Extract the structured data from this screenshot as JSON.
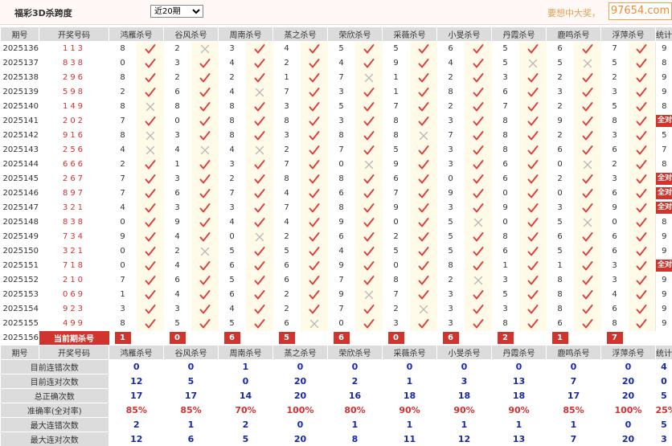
{
  "header": {
    "title": "福彩3D杀跨度",
    "select_value": "近20期",
    "promo": "要想中大奖，",
    "watermark": "97654.com"
  },
  "columns": {
    "period": "期号",
    "draw": "开奖号码",
    "total": "统计",
    "experts": [
      "鸿雁杀号",
      "谷风杀号",
      "周南杀号",
      "蒸之杀号",
      "荣欣杀号",
      "采薇杀号",
      "小旻杀号",
      "丹霞杀号",
      "鹿鸣杀号",
      "浮萍杀号"
    ]
  },
  "rows": [
    {
      "period": "2025136",
      "draw": "113",
      "n": [
        8,
        2,
        3,
        4,
        5,
        5,
        6,
        5,
        6,
        7
      ],
      "m": [
        1,
        0,
        1,
        1,
        1,
        1,
        1,
        1,
        1,
        1
      ],
      "total": "9"
    },
    {
      "period": "2025137",
      "draw": "838",
      "n": [
        0,
        3,
        4,
        2,
        4,
        9,
        4,
        5,
        5,
        5
      ],
      "m": [
        1,
        1,
        1,
        1,
        1,
        1,
        1,
        0,
        0,
        1
      ],
      "total": "8"
    },
    {
      "period": "2025138",
      "draw": "296",
      "n": [
        8,
        2,
        2,
        1,
        7,
        1,
        2,
        3,
        2,
        2
      ],
      "m": [
        1,
        1,
        1,
        1,
        0,
        1,
        1,
        1,
        1,
        1
      ],
      "total": "9"
    },
    {
      "period": "2025139",
      "draw": "598",
      "n": [
        2,
        6,
        4,
        7,
        3,
        1,
        8,
        6,
        3,
        3
      ],
      "m": [
        1,
        1,
        0,
        1,
        1,
        1,
        1,
        1,
        1,
        1
      ],
      "total": "9"
    },
    {
      "period": "2025140",
      "draw": "149",
      "n": [
        8,
        8,
        8,
        3,
        5,
        7,
        2,
        7,
        2,
        5
      ],
      "m": [
        0,
        1,
        1,
        1,
        1,
        1,
        1,
        1,
        1,
        1
      ],
      "total": "8"
    },
    {
      "period": "2025141",
      "draw": "202",
      "n": [
        7,
        0,
        8,
        8,
        3,
        8,
        3,
        8,
        9,
        8
      ],
      "m": [
        1,
        1,
        1,
        1,
        1,
        1,
        1,
        1,
        1,
        1
      ],
      "total": "全对"
    },
    {
      "period": "2025142",
      "draw": "916",
      "n": [
        8,
        3,
        8,
        3,
        8,
        8,
        7,
        8,
        2,
        3
      ],
      "m": [
        0,
        1,
        1,
        1,
        1,
        0,
        1,
        1,
        1,
        1
      ],
      "total": "5"
    },
    {
      "period": "2025143",
      "draw": "256",
      "n": [
        4,
        4,
        4,
        2,
        7,
        5,
        3,
        8,
        6,
        6
      ],
      "m": [
        0,
        0,
        0,
        1,
        1,
        1,
        1,
        1,
        1,
        1
      ],
      "total": "7"
    },
    {
      "period": "2025144",
      "draw": "666",
      "n": [
        2,
        1,
        3,
        7,
        0,
        9,
        3,
        6,
        0,
        2
      ],
      "m": [
        1,
        1,
        1,
        1,
        0,
        1,
        1,
        1,
        0,
        1
      ],
      "total": "8"
    },
    {
      "period": "2025145",
      "draw": "267",
      "n": [
        7,
        3,
        2,
        8,
        8,
        6,
        0,
        6,
        2,
        3
      ],
      "m": [
        1,
        1,
        1,
        1,
        1,
        1,
        1,
        1,
        1,
        1
      ],
      "total": "全对"
    },
    {
      "period": "2025146",
      "draw": "897",
      "n": [
        7,
        6,
        7,
        4,
        6,
        7,
        9,
        0,
        0,
        6
      ],
      "m": [
        1,
        1,
        1,
        1,
        1,
        1,
        1,
        1,
        1,
        1
      ],
      "total": "全对"
    },
    {
      "period": "2025147",
      "draw": "321",
      "n": [
        4,
        3,
        3,
        7,
        8,
        9,
        3,
        9,
        3,
        9
      ],
      "m": [
        1,
        1,
        1,
        1,
        1,
        1,
        1,
        1,
        1,
        1
      ],
      "total": "全对"
    },
    {
      "period": "2025148",
      "draw": "838",
      "n": [
        0,
        9,
        4,
        4,
        9,
        0,
        5,
        0,
        5,
        0
      ],
      "m": [
        1,
        1,
        1,
        1,
        1,
        1,
        0,
        1,
        0,
        1
      ],
      "total": "8"
    },
    {
      "period": "2025149",
      "draw": "734",
      "n": [
        9,
        4,
        0,
        2,
        6,
        2,
        5,
        8,
        6,
        6
      ],
      "m": [
        1,
        1,
        0,
        1,
        1,
        1,
        1,
        1,
        1,
        1
      ],
      "total": "9"
    },
    {
      "period": "2025150",
      "draw": "321",
      "n": [
        0,
        2,
        5,
        5,
        4,
        5,
        5,
        6,
        5,
        6
      ],
      "m": [
        1,
        0,
        1,
        1,
        1,
        1,
        1,
        1,
        1,
        1
      ],
      "total": "9"
    },
    {
      "period": "2025151",
      "draw": "718",
      "n": [
        0,
        4,
        6,
        6,
        9,
        0,
        8,
        1,
        1,
        3
      ],
      "m": [
        1,
        1,
        1,
        1,
        1,
        1,
        1,
        1,
        1,
        1
      ],
      "total": "全对"
    },
    {
      "period": "2025152",
      "draw": "210",
      "n": [
        7,
        6,
        5,
        6,
        7,
        8,
        2,
        3,
        8,
        3
      ],
      "m": [
        1,
        1,
        1,
        1,
        1,
        1,
        0,
        1,
        1,
        1
      ],
      "total": "9"
    },
    {
      "period": "2025153",
      "draw": "069",
      "n": [
        1,
        4,
        6,
        2,
        9,
        7,
        3,
        5,
        8,
        4
      ],
      "m": [
        1,
        1,
        1,
        1,
        0,
        1,
        1,
        1,
        1,
        1
      ],
      "total": "9"
    },
    {
      "period": "2025154",
      "draw": "923",
      "n": [
        3,
        3,
        4,
        2,
        7,
        2,
        3,
        3,
        8,
        6
      ],
      "m": [
        1,
        1,
        1,
        1,
        1,
        0,
        1,
        1,
        1,
        1
      ],
      "total": "9"
    },
    {
      "period": "2025155",
      "draw": "499",
      "n": [
        8,
        5,
        5,
        6,
        0,
        3,
        3,
        8,
        6,
        8
      ],
      "m": [
        1,
        1,
        1,
        0,
        1,
        1,
        1,
        1,
        1,
        1
      ],
      "total": "9"
    }
  ],
  "current": {
    "period": "2025156",
    "label": "当前期杀号",
    "values": [
      "1",
      "0",
      "6",
      "5",
      "6",
      "0",
      "6",
      "2",
      "1",
      "7"
    ]
  },
  "stats": [
    {
      "label": "目前连错次数",
      "values": [
        "0",
        "0",
        "1",
        "0",
        "0",
        "0",
        "0",
        "0",
        "0",
        "0"
      ],
      "total": "4"
    },
    {
      "label": "目前连对次数",
      "values": [
        "12",
        "5",
        "0",
        "20",
        "2",
        "1",
        "3",
        "13",
        "7",
        "20"
      ],
      "total": "0"
    },
    {
      "label": "总正确次数",
      "values": [
        "17",
        "17",
        "14",
        "20",
        "16",
        "18",
        "18",
        "18",
        "17",
        "20"
      ],
      "total": "5"
    },
    {
      "label": "准确率(全对率)",
      "values": [
        "85%",
        "85%",
        "70%",
        "100%",
        "80%",
        "90%",
        "90%",
        "90%",
        "85%",
        "100%"
      ],
      "total": "25%"
    },
    {
      "label": "最大连错次数",
      "values": [
        "2",
        "1",
        "2",
        "0",
        "1",
        "1",
        "1",
        "1",
        "1",
        "0"
      ],
      "total": "5"
    },
    {
      "label": "最大连对次数",
      "values": [
        "12",
        "6",
        "5",
        "20",
        "8",
        "11",
        "12",
        "13",
        "7",
        "20"
      ],
      "total": "3"
    }
  ],
  "colors": {
    "accent_red": "#d0342c",
    "check_red": "#e03c3c",
    "cross_gray": "#b8b8b8",
    "stat_blue": "#1a2a9a",
    "header_gray": "#dcdcdc"
  },
  "icons": {
    "hit": "check-icon",
    "miss": "cross-icon"
  }
}
